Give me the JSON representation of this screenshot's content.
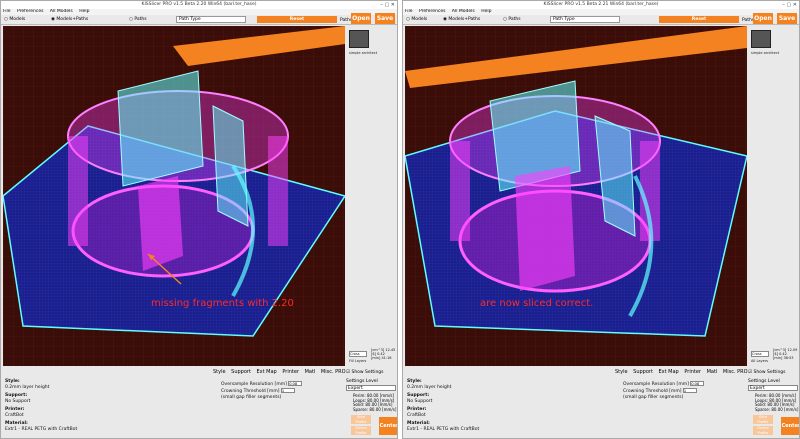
{
  "left": {
    "title": "KISSlicer PRO v1.5 Beta 2.20 Win64 (barl.ter_hase)",
    "menu": [
      "File",
      "Preferences",
      "All Models",
      "Help"
    ],
    "radios": [
      "Models",
      "Models+Paths",
      "Paths"
    ],
    "path_type": "Path Type",
    "reset": "Reset",
    "open": "Open",
    "save": "Save",
    "paths_label": "Paths:",
    "sidebar_name": "simple architect",
    "annotation": "missing fragments with 2.20",
    "view_mode": "Cross",
    "coords": [
      "[cm^3] 12.45",
      "[$] 0.42",
      "[min] 41:16"
    ],
    "display_label": "Fill Layers",
    "tabs": [
      "Style",
      "Support",
      "Ext Map",
      "Printer",
      "Matl",
      "Misc. PRO"
    ],
    "show_settings": "Show Settings",
    "style_label": "Style:",
    "style_value": "0.2mm layer height",
    "support_label": "Support:",
    "support_value": "No Support",
    "printer_label": "Printer:",
    "printer_value": "CraftBot",
    "material_label": "Material:",
    "material_value": "Extr1 - REAL PETG with CraftBot",
    "oversample_label": "Oversample Resolution [mm]",
    "oversample_value": "0.08",
    "crowning_label": "Crowning Threshold [mm]",
    "crowning_sub": "(small gap filler segments)",
    "crowning_value": "1",
    "settings_level_label": "Settings Level",
    "settings_level": "Expert",
    "speeds": [
      "Perim: 80.00 [mm/s]",
      "Loops: 80.00 [mm/s]",
      "Solid: 80.00 [mm/s]",
      "Sparse: 80.00 [mm/s]"
    ],
    "slice_btn": "Slice Profile",
    "delete_btn": "Delete Profile",
    "center": "Center"
  },
  "right": {
    "title": "KISSlicer PRO v1.5 Beta 2.21 Win64 (barl.ter_hase)",
    "menu": [
      "File",
      "Preferences",
      "All Models",
      "Help"
    ],
    "radios": [
      "Models",
      "Models+Paths",
      "Paths"
    ],
    "path_type": "Path Type",
    "reset": "Reset",
    "open": "Open",
    "save": "Save",
    "paths_label": "Paths:",
    "sidebar_name": "simple architect",
    "annotation": "are now sliced correct.",
    "view_mode": "Cross",
    "coords": [
      "[cm^3] 12.09",
      "[$] 0.42",
      "[min] 38:53"
    ],
    "display_label": "All Layers",
    "tabs": [
      "Style",
      "Support",
      "Ext Map",
      "Printer",
      "Matl",
      "Misc. PRO"
    ],
    "show_settings": "Show Settings",
    "style_label": "Style:",
    "style_value": "0.2mm layer height",
    "support_label": "Support:",
    "support_value": "No Support",
    "printer_label": "Printer:",
    "printer_value": "CraftBot",
    "material_label": "Material:",
    "material_value": "Extr1 - REAL PETG with CraftBot",
    "oversample_label": "Oversample Resolution [mm]",
    "oversample_value": "0.08",
    "crowning_label": "Crowning Threshold [mm]",
    "crowning_sub": "(small gap filler segments)",
    "crowning_value": "1",
    "settings_level_label": "Settings Level",
    "settings_level": "Expert",
    "speeds": [
      "Perim: 80.00 [mm/s]",
      "Loops: 80.00 [mm/s]",
      "Solid: 80.00 [mm/s]",
      "Sparse: 80.00 [mm/s]"
    ],
    "slice_btn": "Slice Profile",
    "delete_btn": "Delete Profile",
    "center": "Center"
  },
  "colors": {
    "accent": "#f58220",
    "viewport_bg": "#3a0d08",
    "bed": "#1a1f8a",
    "model_pink": "#ff40ff",
    "model_cyan": "#60ffff",
    "annotation": "#ff2a2a"
  }
}
